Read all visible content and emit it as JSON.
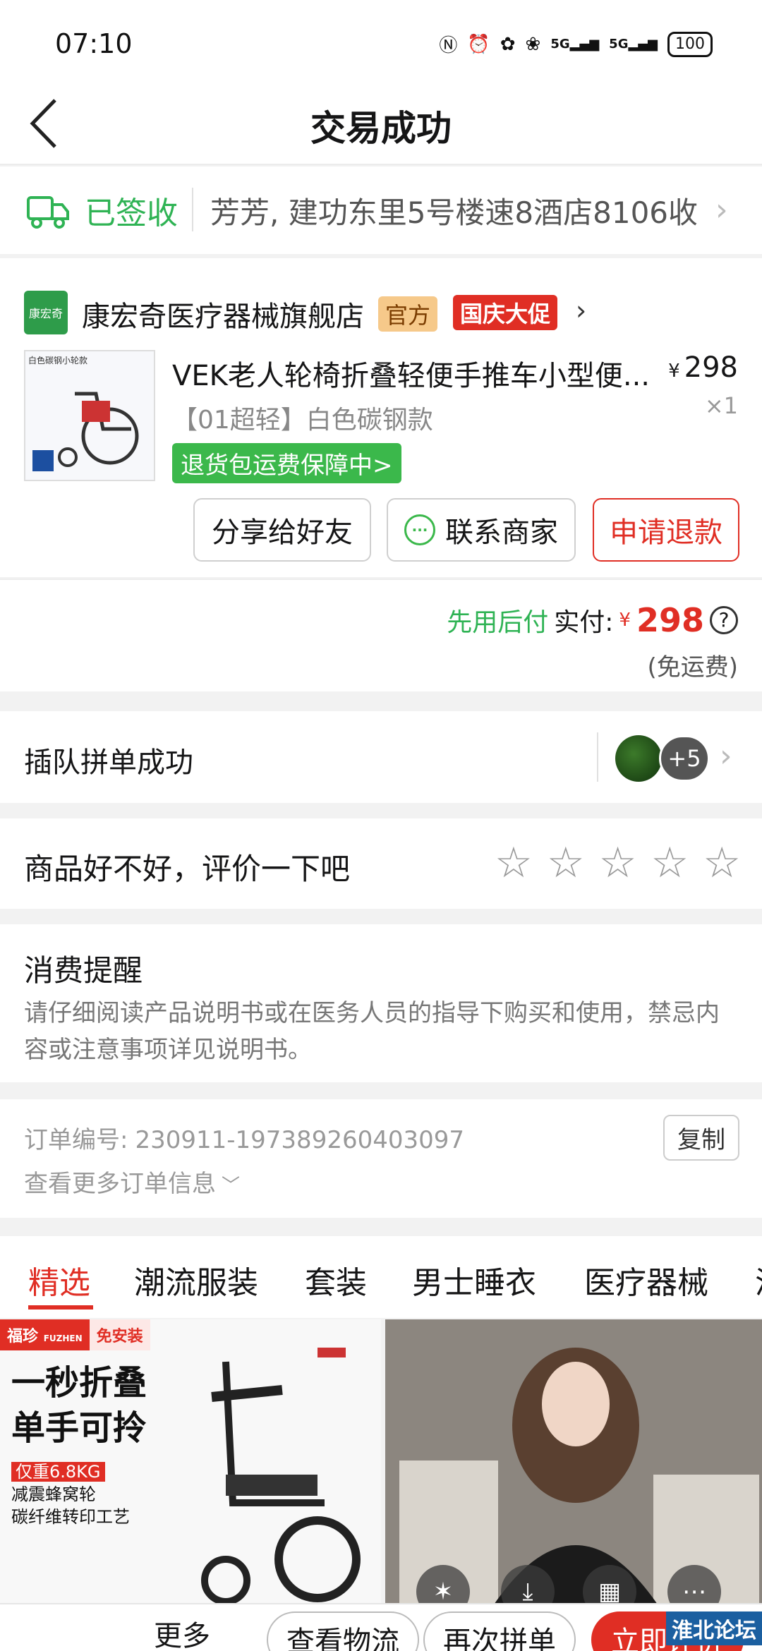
{
  "status_bar": {
    "time": "07:10",
    "battery": "100"
  },
  "header": {
    "title": "交易成功"
  },
  "delivery": {
    "status": "已签收",
    "address": "芳芳, 建功东里5号楼速8酒店8106收"
  },
  "store": {
    "logo_text": "康宏奇",
    "name": "康宏奇医疗器械旗舰店",
    "badge_official": "官方",
    "badge_promo": "国庆大促",
    "product": {
      "image_tag": "白色碳钢小轮款",
      "title": "VEK老人轮椅折叠轻便手推车小型便...",
      "price_currency": "¥",
      "price": "298",
      "quantity": "×1",
      "spec": "【01超轻】白色碳钢款",
      "return_guard": "退货包运费保障中>"
    },
    "buttons": {
      "share": "分享给好友",
      "contact": "联系商家",
      "refund": "申请退款"
    }
  },
  "payment": {
    "method": "先用后付",
    "label": "实付:",
    "currency": "¥",
    "amount": "298",
    "note": "(免运费)"
  },
  "group": {
    "text": "插队拼单成功",
    "more_count": "+5"
  },
  "rating": {
    "text": "商品好不好，评价一下吧",
    "stars": 5
  },
  "reminder": {
    "title": "消费提醒",
    "body": "请仔细阅读产品说明书或在医务人员的指导下购买和使用，禁忌内容或注意事项详见说明书。"
  },
  "order": {
    "label": "订单编号:",
    "number": "230911-197389260403097",
    "copy": "复制",
    "more": "查看更多订单信息"
  },
  "tabs": [
    "精选",
    "潮流服装",
    "套装",
    "男士睡衣",
    "医疗器械",
    "洋"
  ],
  "feed": {
    "left": {
      "brand": "福珍",
      "brand_sub": "FUZHEN",
      "tag": "免安装",
      "headline_1": "一秒折叠",
      "headline_2": "单手可拎",
      "weight": "仅重6.8KG",
      "feature_1": "减震蜂窝轮",
      "feature_2": "碳纤维转印工艺"
    }
  },
  "bottom_bar": {
    "more": "更多",
    "track": "查看物流",
    "rebuy": "再次拼单",
    "pay": "立即评价"
  },
  "watermark": "淮北论坛"
}
